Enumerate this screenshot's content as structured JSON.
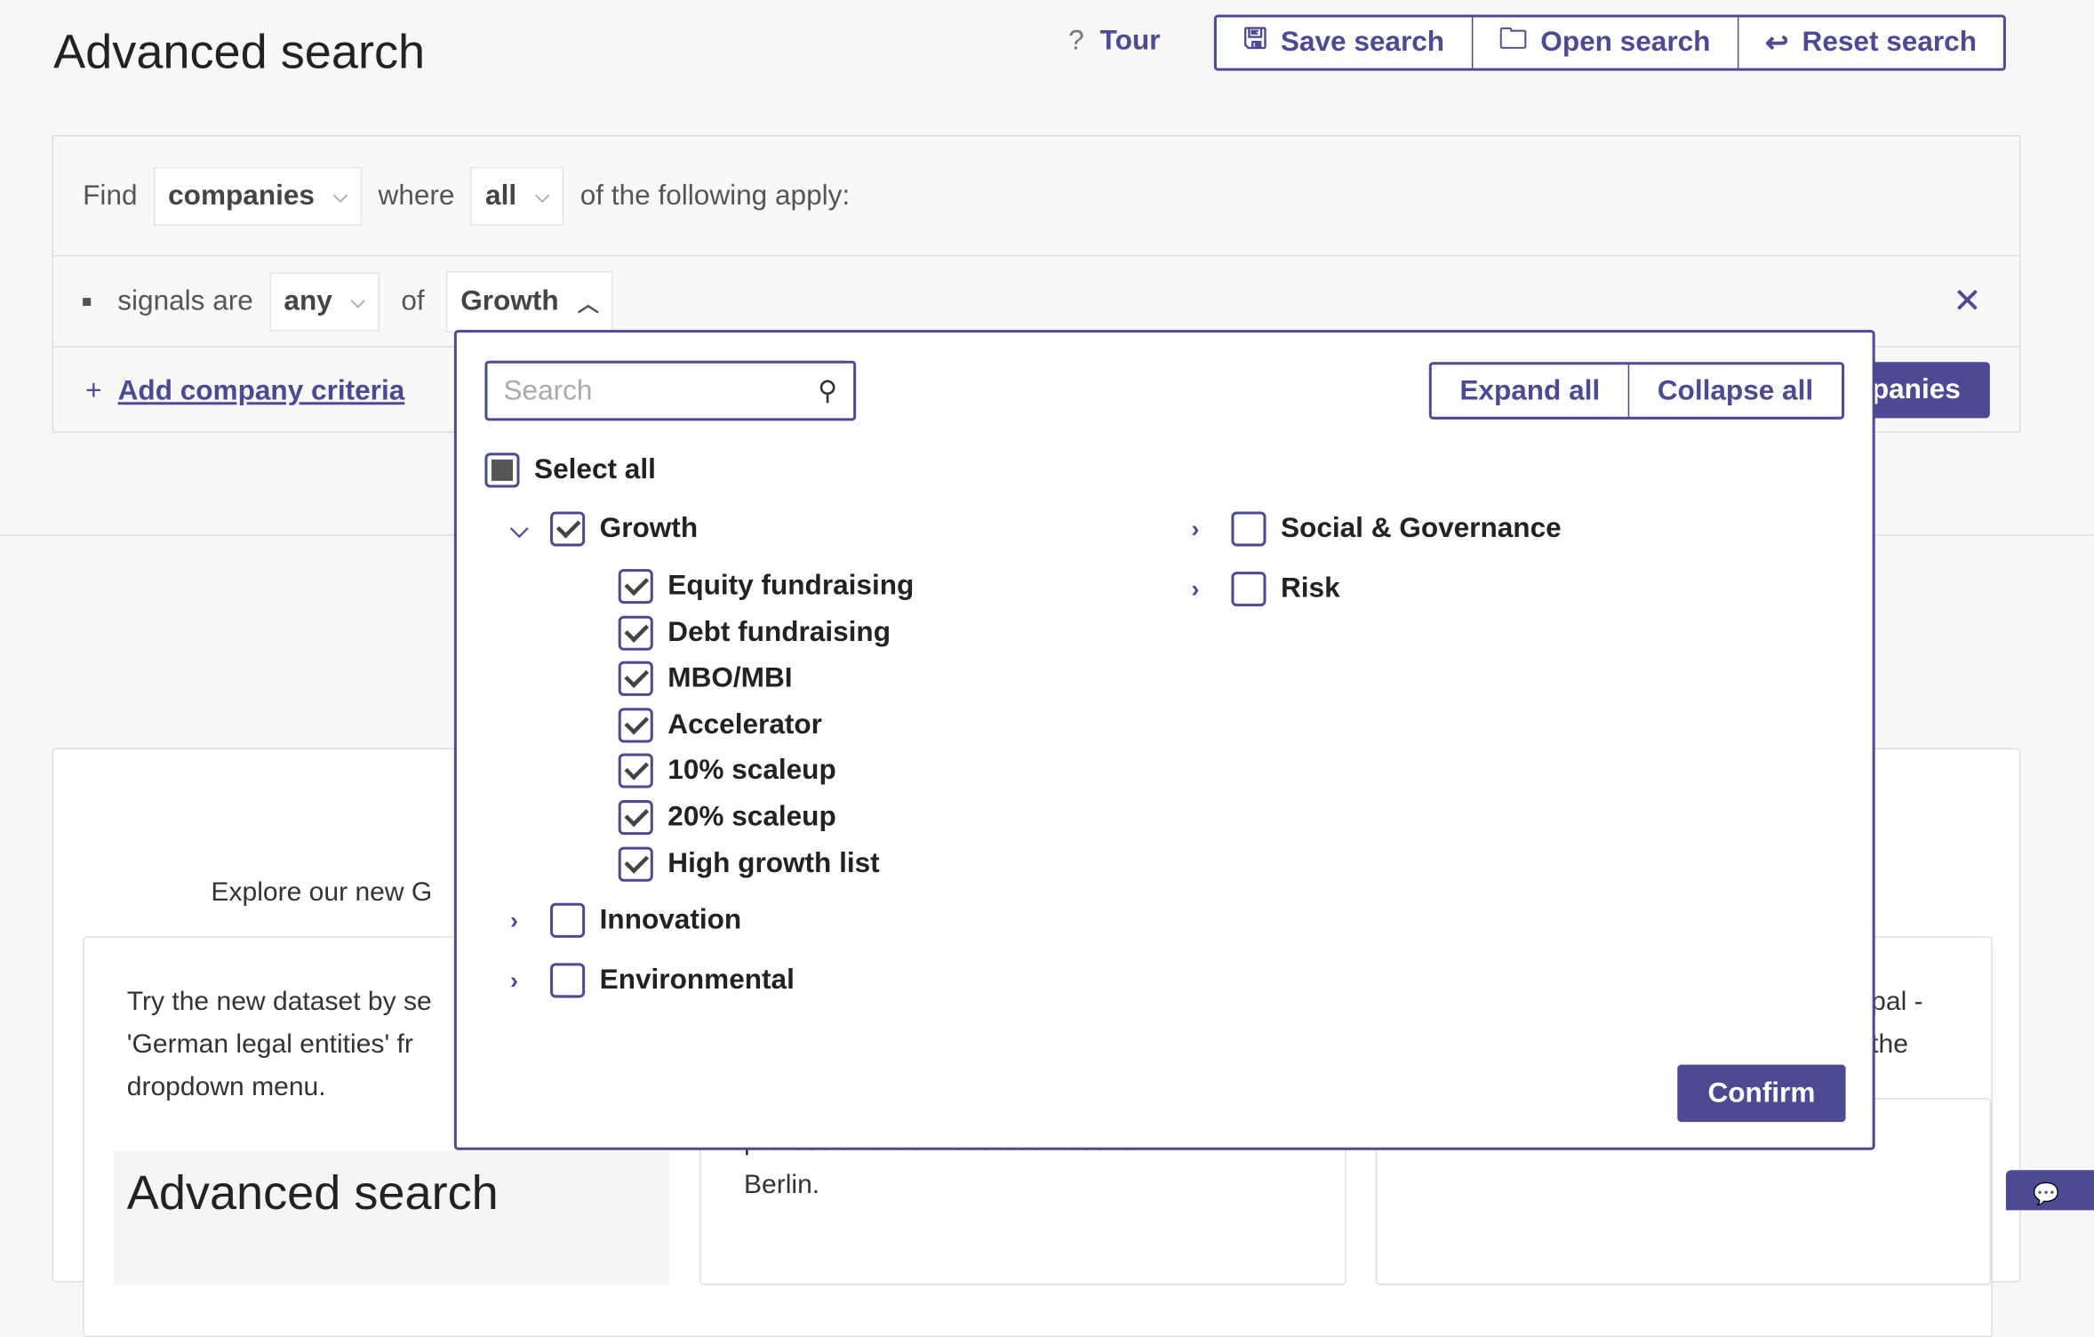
{
  "header": {
    "title": "Advanced search",
    "tour": "Tour",
    "save": "Save search",
    "open": "Open search",
    "reset": "Reset search"
  },
  "criteria": {
    "find": "Find",
    "entity": "companies",
    "where": "where",
    "match": "all",
    "tail": "of the following apply:",
    "signals_label": "signals are",
    "signals_mode": "any",
    "of": "of",
    "signals_value": "Growth",
    "add": "Add company criteria",
    "search_button": "panies"
  },
  "background": {
    "explore": "Explore our new G",
    "try_lines": [
      "Try the new dataset by se",
      "'German legal entities' fr",
      "dropdown menu."
    ],
    "right_lines": [
      "pal -",
      "the"
    ],
    "mid_lines": [
      "professional services businesses in",
      "Berlin."
    ],
    "preview_title": "Advanced search"
  },
  "dropdown": {
    "search_placeholder": "Search",
    "expand": "Expand all",
    "collapse": "Collapse all",
    "select_all": "Select all",
    "confirm": "Confirm",
    "groups": [
      {
        "label": "Growth",
        "checked": true,
        "expanded": true,
        "children": [
          "Equity fundraising",
          "Debt fundraising",
          "MBO/MBI",
          "Accelerator",
          "10% scaleup",
          "20% scaleup",
          "High growth list"
        ]
      },
      {
        "label": "Innovation",
        "checked": false
      },
      {
        "label": "Environmental",
        "checked": false
      },
      {
        "label": "Social & Governance",
        "checked": false
      },
      {
        "label": "Risk",
        "checked": false
      }
    ]
  },
  "colors": {
    "accent": "#4b4a93",
    "background": "#f7f7f7"
  }
}
